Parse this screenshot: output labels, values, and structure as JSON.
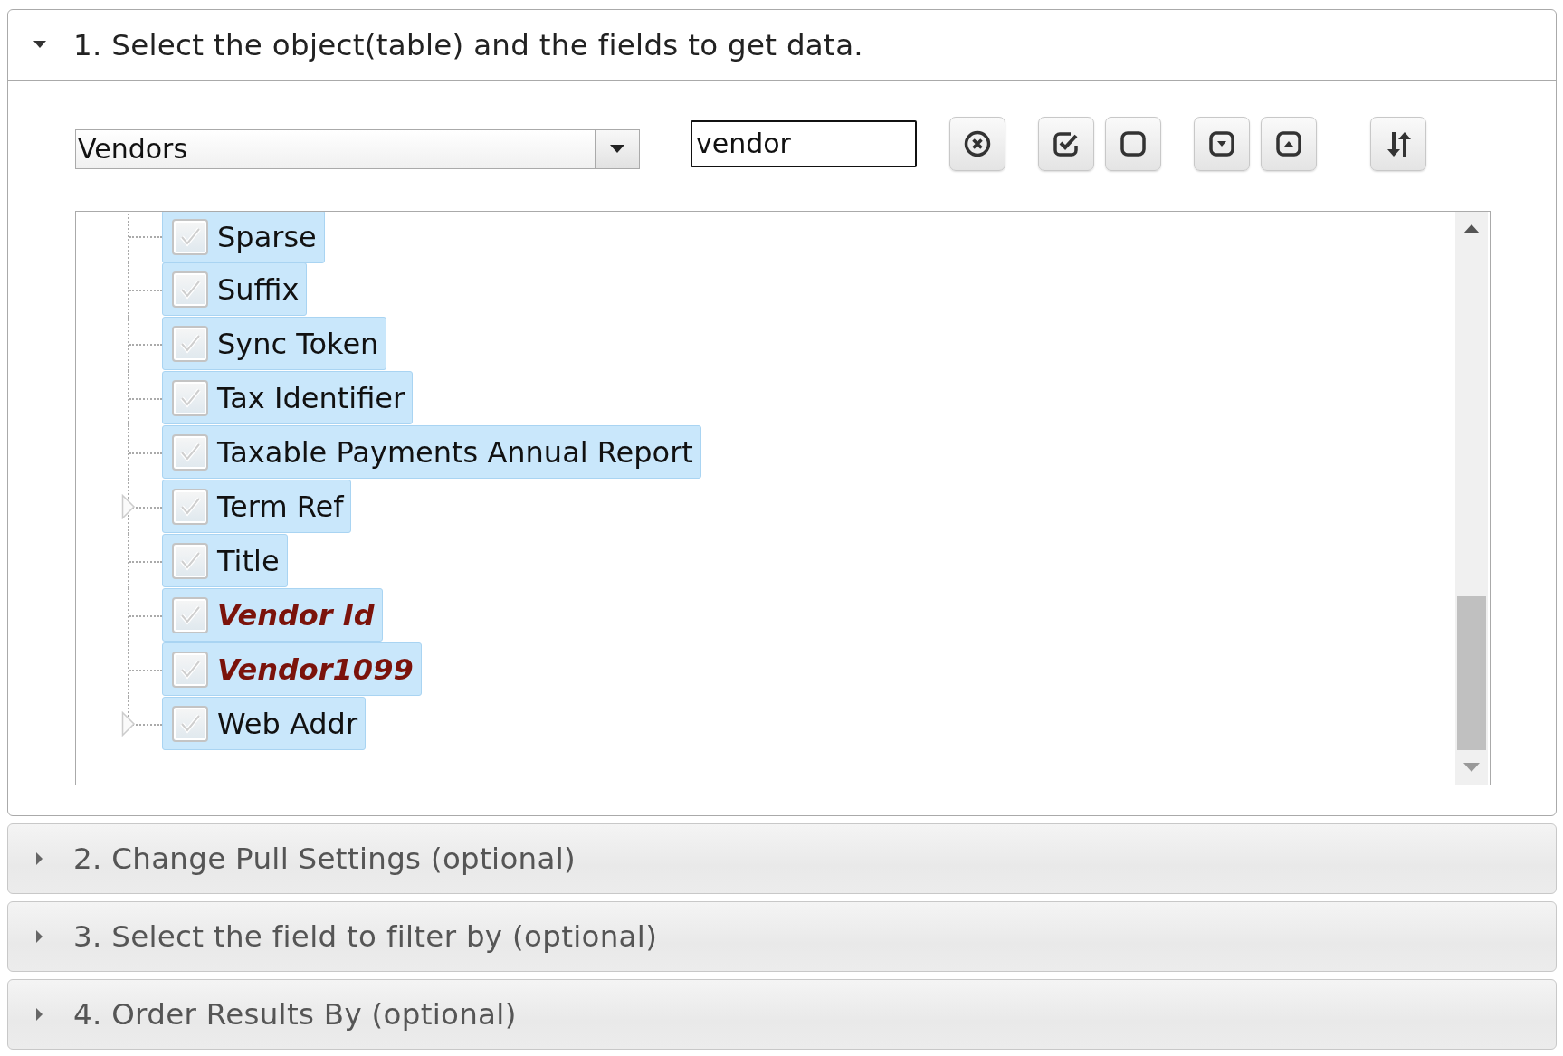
{
  "sections": [
    {
      "title": "1. Select the object(table) and the fields to get data.",
      "expanded": true,
      "object_select": {
        "value": "Vendors"
      },
      "search": {
        "value": "vendor"
      },
      "fields": [
        {
          "label": "Sparse",
          "kind": "field",
          "checked": true,
          "expandable": false
        },
        {
          "label": "Suffix",
          "kind": "field",
          "checked": true,
          "expandable": false
        },
        {
          "label": "Sync Token",
          "kind": "field",
          "checked": true,
          "expandable": false
        },
        {
          "label": "Tax Identifier",
          "kind": "field",
          "checked": true,
          "expandable": false
        },
        {
          "label": "Taxable Payments Annual Report",
          "kind": "field",
          "checked": true,
          "expandable": false
        },
        {
          "label": "Term Ref",
          "kind": "field",
          "checked": true,
          "expandable": true
        },
        {
          "label": "Title",
          "kind": "field",
          "checked": true,
          "expandable": false
        },
        {
          "label": "Vendor Id",
          "kind": "key",
          "checked": true,
          "expandable": false
        },
        {
          "label": "Vendor1099",
          "kind": "key",
          "checked": true,
          "expandable": false
        },
        {
          "label": "Web Addr",
          "kind": "field",
          "checked": true,
          "expandable": true
        }
      ]
    },
    {
      "title": "2. Change Pull Settings (optional)",
      "expanded": false
    },
    {
      "title": "3. Select the field to filter by (optional)",
      "expanded": false
    },
    {
      "title": "4. Order Results By (optional)",
      "expanded": false
    }
  ]
}
